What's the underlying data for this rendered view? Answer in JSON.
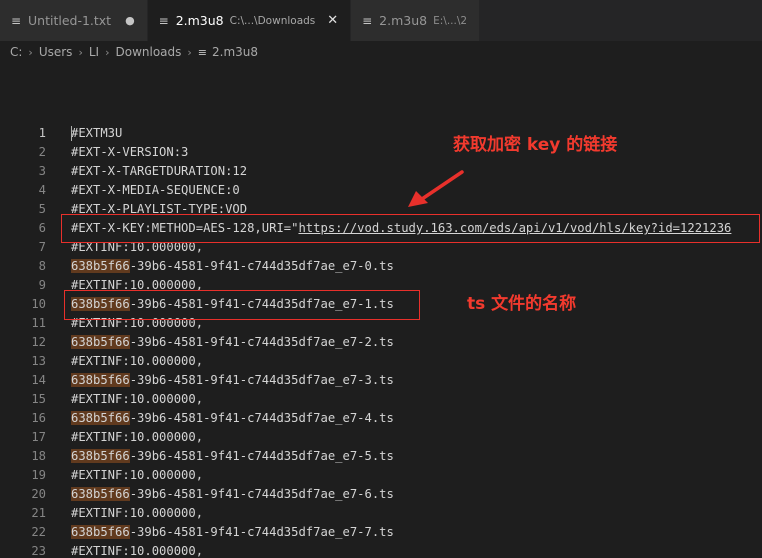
{
  "tabs": [
    {
      "name": "Untitled-1.txt",
      "description": "",
      "modified_indicator": "●",
      "icon": "text-file-icon",
      "active": false
    },
    {
      "name": "2.m3u8",
      "description": "C:\\...\\Downloads",
      "close_glyph": "✕",
      "icon": "text-file-icon",
      "active": true
    },
    {
      "name": "2.m3u8",
      "description": "E:\\...\\2",
      "icon": "text-file-icon",
      "active": false
    }
  ],
  "breadcrumb": {
    "segments": [
      "C:",
      "Users",
      "LI",
      "Downloads"
    ],
    "file": "2.m3u8",
    "separator": "›"
  },
  "editor": {
    "cursor_line": 1,
    "highlight_token": "638b5f66",
    "lines": [
      {
        "n": "1",
        "text": "#EXTM3U"
      },
      {
        "n": "2",
        "text": "#EXT-X-VERSION:3"
      },
      {
        "n": "3",
        "text": "#EXT-X-TARGETDURATION:12"
      },
      {
        "n": "4",
        "text": "#EXT-X-MEDIA-SEQUENCE:0"
      },
      {
        "n": "5",
        "text": "#EXT-X-PLAYLIST-TYPE:VOD"
      },
      {
        "n": "6",
        "prefix": "#EXT-X-KEY:METHOD=AES-128,URI=\"",
        "url": "https://vod.study.163.com/eds/api/v1/vod/hls/key?id=1221236"
      },
      {
        "n": "7",
        "text": "#EXTINF:10.000000,"
      },
      {
        "n": "8",
        "hl": "638b5f66",
        "rest": "-39b6-4581-9f41-c744d35df7ae_e7-0.ts"
      },
      {
        "n": "9",
        "text": "#EXTINF:10.000000,"
      },
      {
        "n": "10",
        "hl": "638b5f66",
        "rest": "-39b6-4581-9f41-c744d35df7ae_e7-1.ts"
      },
      {
        "n": "11",
        "text": "#EXTINF:10.000000,"
      },
      {
        "n": "12",
        "hl": "638b5f66",
        "rest": "-39b6-4581-9f41-c744d35df7ae_e7-2.ts"
      },
      {
        "n": "13",
        "text": "#EXTINF:10.000000,"
      },
      {
        "n": "14",
        "hl": "638b5f66",
        "rest": "-39b6-4581-9f41-c744d35df7ae_e7-3.ts"
      },
      {
        "n": "15",
        "text": "#EXTINF:10.000000,"
      },
      {
        "n": "16",
        "hl": "638b5f66",
        "rest": "-39b6-4581-9f41-c744d35df7ae_e7-4.ts"
      },
      {
        "n": "17",
        "text": "#EXTINF:10.000000,"
      },
      {
        "n": "18",
        "hl": "638b5f66",
        "rest": "-39b6-4581-9f41-c744d35df7ae_e7-5.ts"
      },
      {
        "n": "19",
        "text": "#EXTINF:10.000000,"
      },
      {
        "n": "20",
        "hl": "638b5f66",
        "rest": "-39b6-4581-9f41-c744d35df7ae_e7-6.ts"
      },
      {
        "n": "21",
        "text": "#EXTINF:10.000000,"
      },
      {
        "n": "22",
        "hl": "638b5f66",
        "rest": "-39b6-4581-9f41-c744d35df7ae_e7-7.ts"
      },
      {
        "n": "23",
        "text": "#EXTINF:10.000000,"
      }
    ]
  },
  "annotations": {
    "key_link_label": "获取加密 key 的链接",
    "ts_name_label": "ts 文件的名称",
    "color": "#f23a2e"
  },
  "colors": {
    "editor_bg": "#1e1e1e",
    "tabbar_bg": "#252526",
    "highlight_bg": "#613a1e",
    "annotation_red": "#e8302b"
  }
}
